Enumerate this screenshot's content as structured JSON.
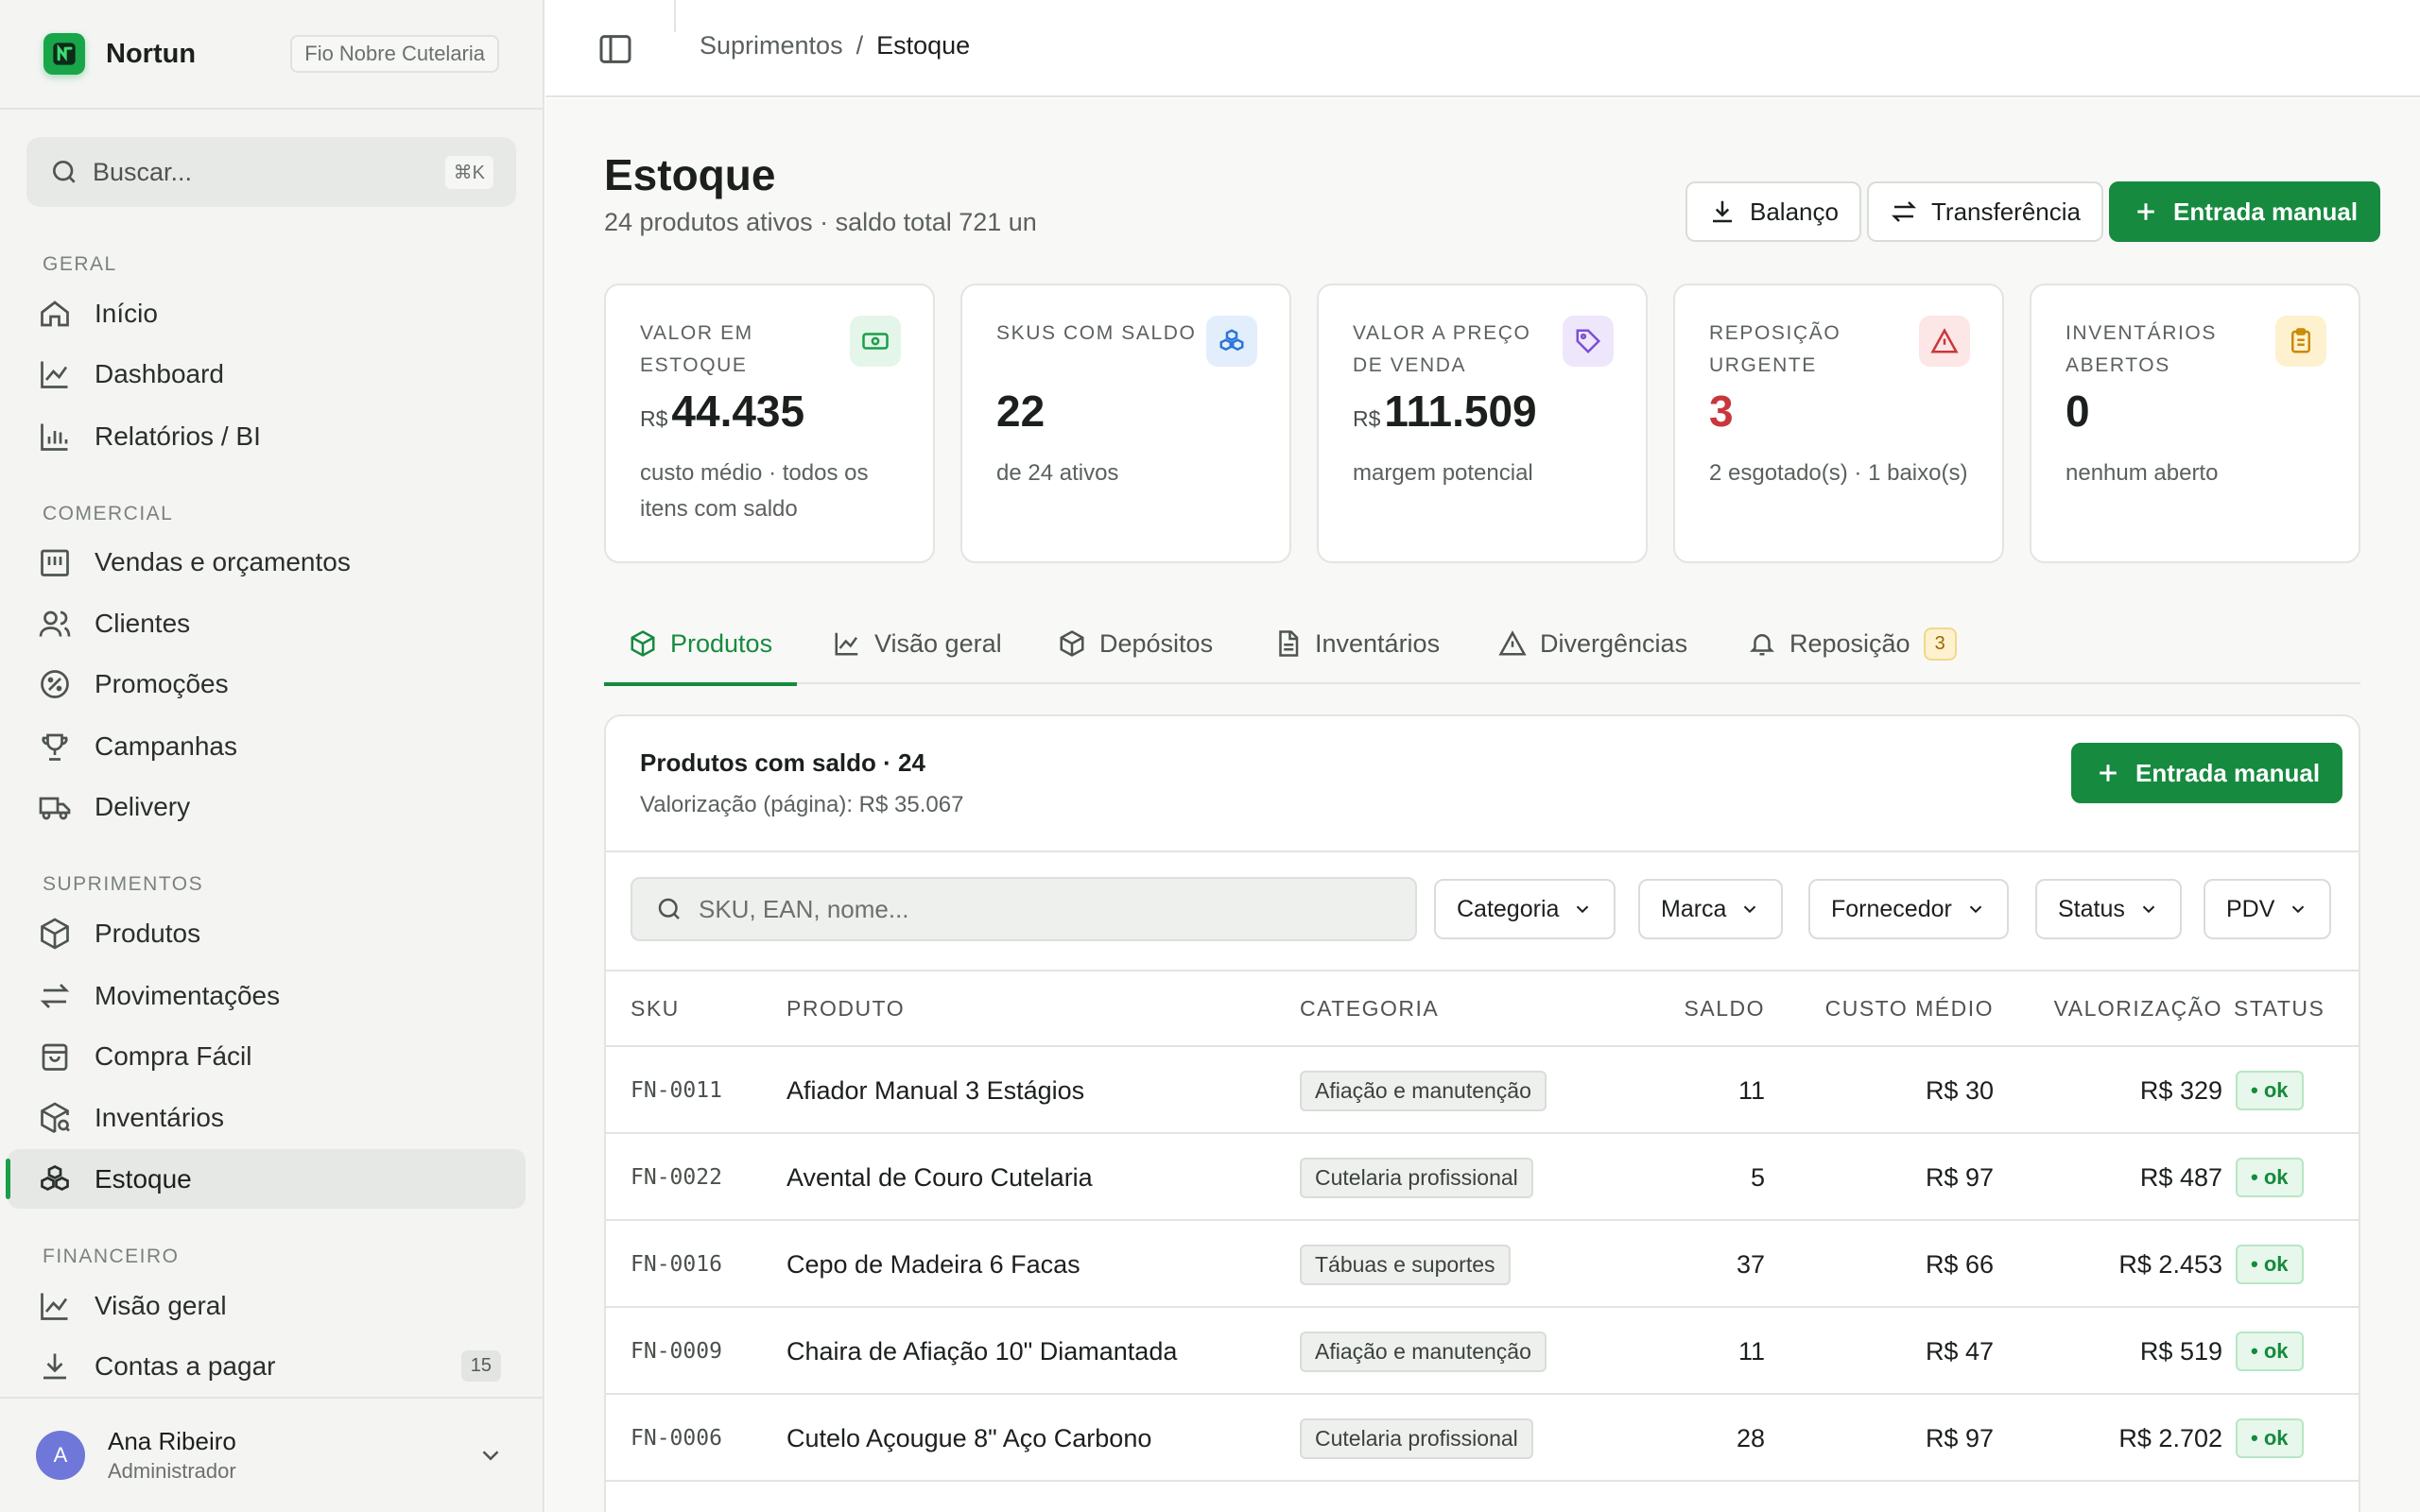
{
  "sidebar": {
    "brand": "Nortun",
    "org": "Fio Nobre Cutelaria",
    "search_placeholder": "Buscar...",
    "search_shortcut": "⌘K",
    "sections": [
      "GERAL",
      "COMERCIAL",
      "SUPRIMENTOS",
      "FINANCEIRO"
    ],
    "items": [
      {
        "label": "Início",
        "icon": "home-icon"
      },
      {
        "label": "Dashboard",
        "icon": "line-chart-icon"
      },
      {
        "label": "Relatórios / BI",
        "icon": "bar-chart-icon"
      },
      {
        "label": "Vendas e orçamentos",
        "icon": "store-icon"
      },
      {
        "label": "Clientes",
        "icon": "users-icon"
      },
      {
        "label": "Promoções",
        "icon": "discount-icon"
      },
      {
        "label": "Campanhas",
        "icon": "trophy-icon"
      },
      {
        "label": "Delivery",
        "icon": "truck-icon"
      },
      {
        "label": "Produtos",
        "icon": "package-icon"
      },
      {
        "label": "Movimentações",
        "icon": "arrows-icon"
      },
      {
        "label": "Compra Fácil",
        "icon": "shopping-bag-icon"
      },
      {
        "label": "Inventários",
        "icon": "package-search-icon"
      },
      {
        "label": "Estoque",
        "icon": "boxes-icon",
        "active": true
      },
      {
        "label": "Visão geral",
        "icon": "line-chart-icon"
      },
      {
        "label": "Contas a pagar",
        "icon": "download-icon",
        "count": "15"
      }
    ],
    "user": {
      "initial": "A",
      "name": "Ana Ribeiro",
      "role": "Administrador"
    }
  },
  "topbar": {
    "breadcrumb": [
      "Suprimentos",
      "/",
      "Estoque"
    ]
  },
  "page": {
    "title": "Estoque",
    "subtitle": "24 produtos ativos · saldo total 721 un",
    "actions": {
      "balanco": "Balanço",
      "transferencia": "Transferência",
      "entrada": "Entrada manual"
    }
  },
  "kpis": [
    {
      "label": "VALOR EM ESTOQUE",
      "currency": "R$",
      "value": "44.435",
      "note": "custo médio · todos os itens com saldo",
      "icon": "banknote-icon",
      "color": "#1a9e48",
      "bg": "#e4f5e9"
    },
    {
      "label": "SKUS COM SALDO",
      "currency": "",
      "value": "22",
      "note": "de 24 ativos",
      "icon": "boxes-icon",
      "color": "#2b74d9",
      "bg": "#e3eefc"
    },
    {
      "label": "VALOR A PREÇO DE VENDA",
      "currency": "R$",
      "value": "111.509",
      "note": "margem potencial",
      "icon": "tag-icon",
      "color": "#7c4fd4",
      "bg": "#eee7fb"
    },
    {
      "label": "REPOSIÇÃO URGENTE",
      "currency": "",
      "value": "3",
      "note": "2 esgotado(s) · 1 baixo(s)",
      "icon": "alert-triangle-icon",
      "color": "#c9373b",
      "bg": "#fce6e6",
      "value_color": "#c9373b"
    },
    {
      "label": "INVENTÁRIOS ABERTOS",
      "currency": "",
      "value": "0",
      "note": "nenhum aberto",
      "icon": "clipboard-icon",
      "color": "#c98a00",
      "bg": "#fdf1cf"
    }
  ],
  "tabs": [
    {
      "label": "Produtos",
      "icon": "package-icon",
      "active": true
    },
    {
      "label": "Visão geral",
      "icon": "line-chart-icon"
    },
    {
      "label": "Depósitos",
      "icon": "package-icon"
    },
    {
      "label": "Inventários",
      "icon": "file-text-icon"
    },
    {
      "label": "Divergências",
      "icon": "alert-triangle-icon"
    },
    {
      "label": "Reposição",
      "icon": "bell-icon",
      "badge": "3"
    }
  ],
  "table_card": {
    "title": "Produtos com saldo · 24",
    "subtitle": "Valorização (página): R$ 35.067",
    "action": "Entrada manual",
    "search_placeholder": "SKU, EAN, nome...",
    "filters": [
      "Categoria",
      "Marca",
      "Fornecedor",
      "Status",
      "PDV"
    ],
    "columns": [
      "SKU",
      "PRODUTO",
      "CATEGORIA",
      "SALDO",
      "CUSTO MÉDIO",
      "VALORIZAÇÃO",
      "STATUS"
    ],
    "rows": [
      {
        "sku": "FN-0011",
        "produto": "Afiador Manual 3 Estágios",
        "categoria": "Afiação e manutenção",
        "saldo": "11",
        "custo": "R$ 30",
        "valor": "R$ 329",
        "status": "• ok"
      },
      {
        "sku": "FN-0022",
        "produto": "Avental de Couro Cutelaria",
        "categoria": "Cutelaria profissional",
        "saldo": "5",
        "custo": "R$ 97",
        "valor": "R$ 487",
        "status": "• ok"
      },
      {
        "sku": "FN-0016",
        "produto": "Cepo de Madeira 6 Facas",
        "categoria": "Tábuas e suportes",
        "saldo": "37",
        "custo": "R$ 66",
        "valor": "R$ 2.453",
        "status": "• ok"
      },
      {
        "sku": "FN-0009",
        "produto": "Chaira de Afiação 10\" Diamantada",
        "categoria": "Afiação e manutenção",
        "saldo": "11",
        "custo": "R$ 47",
        "valor": "R$ 519",
        "status": "• ok"
      },
      {
        "sku": "FN-0006",
        "produto": "Cutelo Açougue 8\" Aço Carbono",
        "categoria": "Cutelaria profissional",
        "saldo": "28",
        "custo": "R$ 97",
        "valor": "R$ 2.702",
        "status": "• ok"
      }
    ]
  }
}
